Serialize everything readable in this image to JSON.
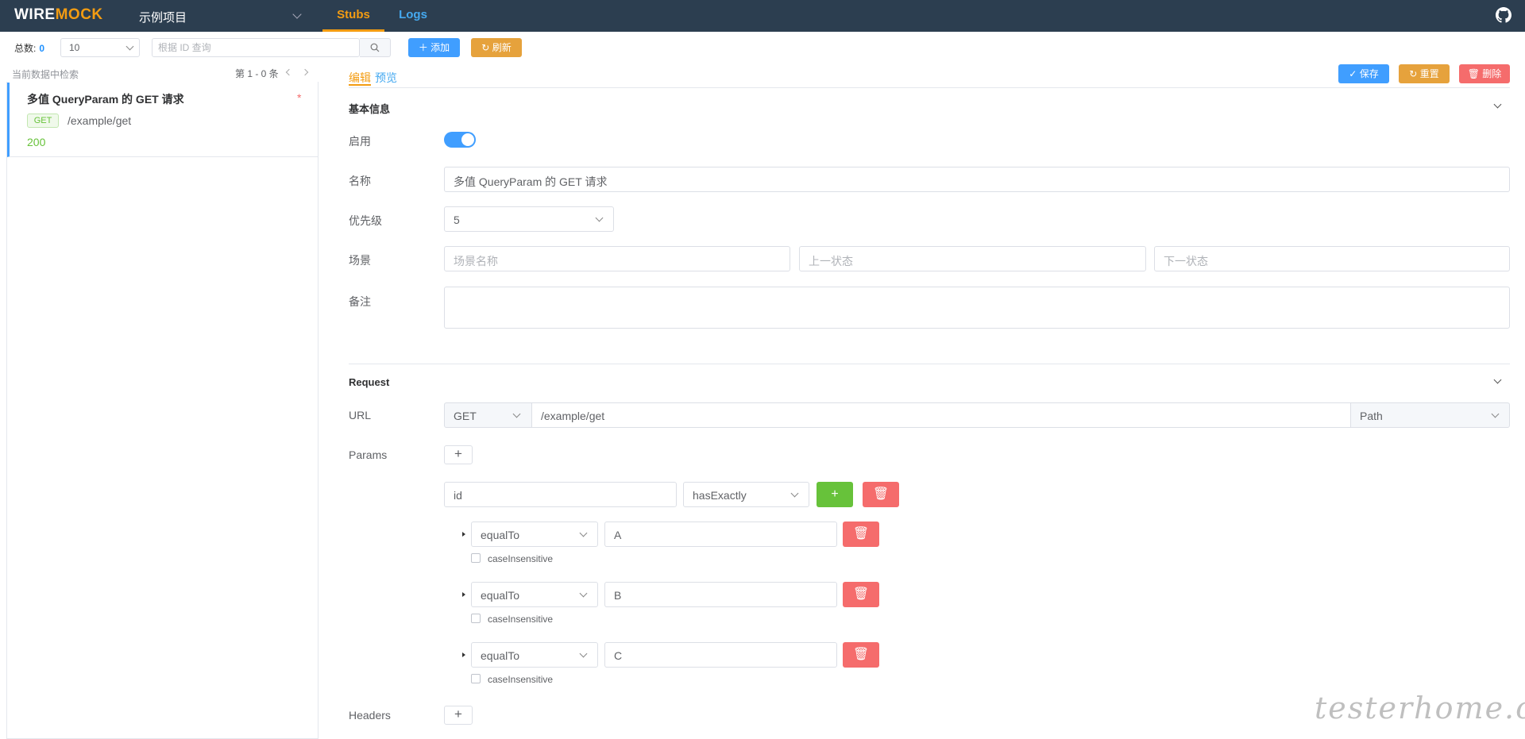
{
  "nav": {
    "logo_a": "WIRE",
    "logo_b": "MOCK",
    "project": "示例项目",
    "tabs": [
      {
        "label": "Stubs",
        "active": true
      },
      {
        "label": "Logs",
        "active": false
      }
    ],
    "github_icon": "github-icon"
  },
  "toolbar": {
    "total_label": "总数:",
    "total_value": "0",
    "page_size": "10",
    "search_placeholder": "根据 ID 查询",
    "add_label": "添加",
    "refresh_label": "刷新"
  },
  "list": {
    "hint": "当前数据中检索",
    "pager": "第 1 - 0 条",
    "items": [
      {
        "title": "多值 QueryParam 的 GET 请求",
        "modified_mark": "*",
        "method": "GET",
        "url": "/example/get",
        "status": "200"
      }
    ]
  },
  "editor": {
    "tab_edit": "编辑",
    "tab_preview": "预览",
    "save_label": "保存",
    "reset_label": "重置",
    "delete_label": "删除",
    "basic": {
      "title": "基本信息",
      "enabled_label": "启用",
      "enabled": true,
      "name_label": "名称",
      "name_value": "多值 QueryParam 的 GET 请求",
      "priority_label": "优先级",
      "priority_value": "5",
      "scenario_label": "场景",
      "scenario_placeholder": "场景名称",
      "prev_state_placeholder": "上一状态",
      "next_state_placeholder": "下一状态",
      "note_label": "备注",
      "note_value": ""
    },
    "request": {
      "title": "Request",
      "url_label": "URL",
      "method": "GET",
      "url_value": "/example/get",
      "url_match": "Path",
      "params_label": "Params",
      "param": {
        "key": "id",
        "operator": "hasExactly",
        "matchers": [
          {
            "op": "equalTo",
            "value": "A",
            "case_label": "caseInsensitive"
          },
          {
            "op": "equalTo",
            "value": "B",
            "case_label": "caseInsensitive"
          },
          {
            "op": "equalTo",
            "value": "C",
            "case_label": "caseInsensitive"
          }
        ]
      },
      "headers_label": "Headers"
    }
  },
  "watermark": "testerhome.com",
  "colors": {
    "nav_bg": "#2c3e50",
    "accent": "#f39c12",
    "primary": "#409eff",
    "danger": "#f56c6c",
    "success": "#67c23a",
    "warning": "#e6a23c"
  }
}
